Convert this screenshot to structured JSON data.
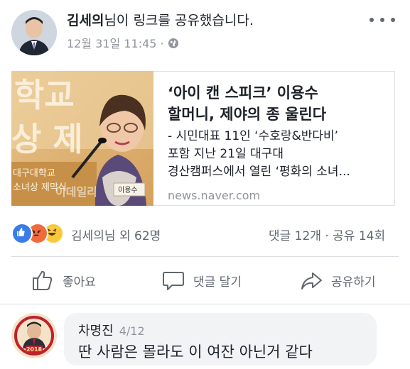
{
  "post": {
    "poster_name": "김세의",
    "poster_action": "님이 링크를 공유했습니다.",
    "timestamp": "12월 31일 11:45",
    "dot": "·",
    "privacy_icon": "globe-icon",
    "more_icon": "ellipsis-icon"
  },
  "link": {
    "title_line1": "‘아이 캔 스피크’ 이용수",
    "title_line2": "할머니, 제야의 종 울린다",
    "desc_line1": "- 시민대표 11인 ‘수호랑&반다비’",
    "desc_line2": "포함 지난 21일 대구대",
    "desc_line3": "경산캠퍼스에서 열린 ‘평화의 소녀...",
    "domain": "news.naver.com",
    "thumb_bg_line1": "학교",
    "thumb_bg_line2": "상 제",
    "thumb_banner_line1": "대구대학교",
    "thumb_banner_line2": "소녀상 제막식",
    "thumb_watermark": "이데일리",
    "thumb_nameplate": "이용수"
  },
  "reactions": {
    "icons": [
      "like-reaction",
      "angry-reaction",
      "haha-reaction"
    ],
    "summary": "김세의님 외 62명",
    "counts": "댓글 12개 · 공유 14회"
  },
  "actions": {
    "like": "좋아요",
    "comment": "댓글 달기",
    "share": "공유하기"
  },
  "comment": {
    "author": "차명진",
    "time": "4/12",
    "text": "딴 사람은 몰라도 이 여잔 아닌거 같다",
    "avatar_badge": "2018"
  },
  "colors": {
    "text": "#1d2129",
    "secondary": "#606770",
    "meta": "#90949c",
    "like_blue": "#3b7bea",
    "bubble": "#f2f3f5"
  }
}
